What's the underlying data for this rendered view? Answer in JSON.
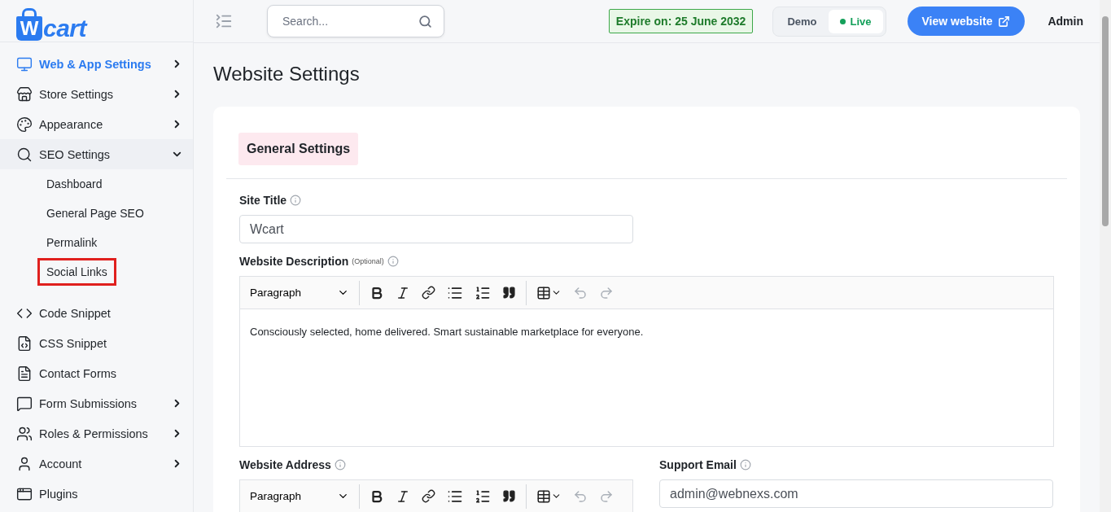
{
  "logo": {
    "mark": "W",
    "text": "cart"
  },
  "sidebar": {
    "items": [
      {
        "label": "Web & App Settings",
        "active": true,
        "expanded": false
      },
      {
        "label": "Store Settings",
        "active": false,
        "expanded": false
      },
      {
        "label": "Appearance",
        "active": false,
        "expanded": false
      },
      {
        "label": "SEO Settings",
        "active": false,
        "expanded": true,
        "children": [
          {
            "label": "Dashboard",
            "highlighted": false
          },
          {
            "label": "General Page SEO",
            "highlighted": false
          },
          {
            "label": "Permalink",
            "highlighted": false
          },
          {
            "label": "Social Links",
            "highlighted": true
          }
        ]
      },
      {
        "label": "Code Snippet",
        "active": false
      },
      {
        "label": "CSS Snippet",
        "active": false
      },
      {
        "label": "Contact Forms",
        "active": false
      },
      {
        "label": "Form Submissions",
        "active": false,
        "expanded": false
      },
      {
        "label": "Roles & Permissions",
        "active": false,
        "expanded": false
      },
      {
        "label": "Account",
        "active": false,
        "expanded": false
      },
      {
        "label": "Plugins",
        "active": false
      }
    ]
  },
  "topbar": {
    "search": {
      "placeholder": "Search..."
    },
    "expiry": "Expire on: 25 June 2032",
    "modes": [
      {
        "label": "Demo",
        "selected": false
      },
      {
        "label": "Live",
        "selected": true
      }
    ],
    "view_button": "View website",
    "user": "Admin"
  },
  "page": {
    "title": "Website Settings",
    "section": "General Settings",
    "site_title": {
      "label": "Site Title",
      "value": "Wcart"
    },
    "description": {
      "label": "Website Description",
      "note": "(Optional)",
      "format": "Paragraph",
      "text": "Consciously selected, home delivered. Smart sustainable marketplace for everyone."
    },
    "address": {
      "label": "Website Address",
      "format": "Paragraph"
    },
    "support_email": {
      "label": "Support Email",
      "value": "admin@webnexs.com"
    }
  }
}
